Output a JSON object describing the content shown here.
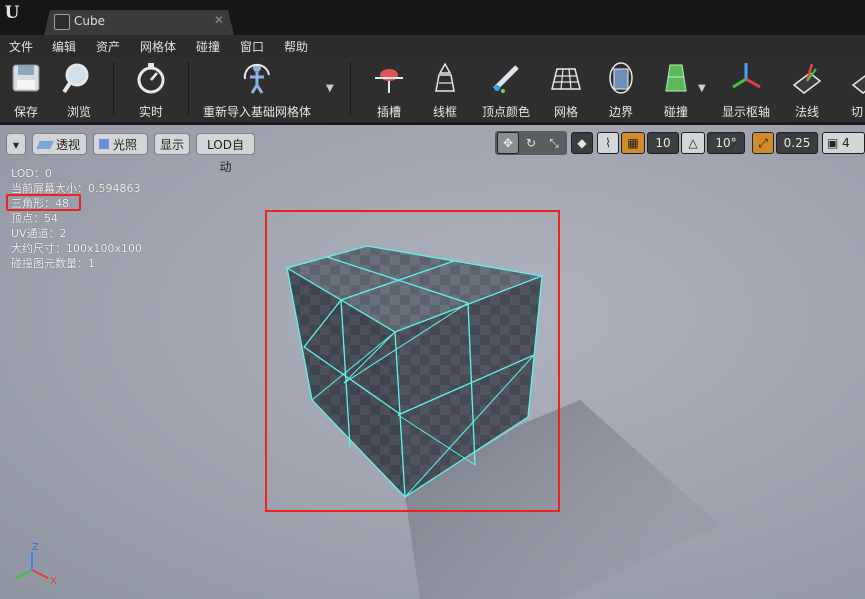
{
  "titlebar": {
    "tab_title": "Cube"
  },
  "menu": [
    "文件",
    "编辑",
    "资产",
    "网格体",
    "碰撞",
    "窗口",
    "帮助"
  ],
  "toolbar": [
    {
      "label": "保存",
      "icon": "save-icon"
    },
    {
      "label": "浏览",
      "icon": "browse-icon"
    },
    {
      "label": "实时",
      "icon": "realtime-icon"
    },
    {
      "label": "重新导入基础网格体",
      "icon": "reimport-icon"
    },
    {
      "label": "插槽",
      "icon": "socket-icon"
    },
    {
      "label": "线框",
      "icon": "wireframe-icon"
    },
    {
      "label": "顶点颜色",
      "icon": "vertex-color-icon"
    },
    {
      "label": "网格",
      "icon": "grid-icon"
    },
    {
      "label": "边界",
      "icon": "bounds-icon"
    },
    {
      "label": "碰撞",
      "icon": "collision-icon"
    },
    {
      "label": "显示枢轴",
      "icon": "pivot-icon"
    },
    {
      "label": "法线",
      "icon": "normals-icon"
    },
    {
      "label": "切",
      "icon": "tangents-icon"
    }
  ],
  "viewport_toolbar": {
    "perspective": "透视",
    "lit": "光照",
    "show": "显示",
    "lod": "LOD自动",
    "grid_snap": "10",
    "rotate_snap": "10°",
    "scale_snap": "0.25",
    "camera_speed": "4"
  },
  "stats": [
    "LOD：0",
    "当前屏幕大小：0.594863",
    "三角形：48",
    "顶点：54",
    "UV通道：2",
    "大约尺寸：100x100x100",
    "碰撞图元数量：1"
  ],
  "axes": {
    "z": "Z",
    "x": "X"
  },
  "colors": {
    "wire": "#5ff3f0",
    "highlight": "#e22222",
    "snap_active": "#d18a2c"
  }
}
